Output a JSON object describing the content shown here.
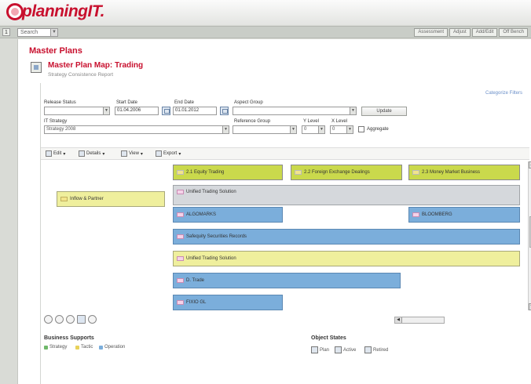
{
  "app": {
    "logo_text": "planningIT."
  },
  "nav": {
    "left_button": "1",
    "select_value": "Search",
    "links": [
      "Assessment",
      "Adjust",
      "Add/Edit",
      "Off Bench"
    ]
  },
  "page": {
    "title": "Master Plans"
  },
  "report": {
    "title": "Master Plan Map: Trading",
    "subtitle": "Strategy Consistence Report"
  },
  "filters": {
    "categorize_link": "Categorize Filters",
    "release_status": {
      "label": "Release Status",
      "value": ""
    },
    "start_date": {
      "label": "Start Date",
      "value": "01.04.2006"
    },
    "end_date": {
      "label": "End Date",
      "value": "01.01.2012"
    },
    "aspect_group": {
      "label": "Aspect Group",
      "value": ""
    },
    "update_button": "Update",
    "it_strategy": {
      "label": "IT Strategy",
      "value": "Strategy 2008"
    },
    "reference_group": {
      "label": "Reference Group",
      "value": ""
    },
    "y_level": {
      "label": "Y Level",
      "value": "0"
    },
    "x_level": {
      "label": "X Level",
      "value": "0"
    },
    "aggregate_label": "Aggregate"
  },
  "toolbar": {
    "edit": "Edit",
    "details": "Details",
    "view": "View",
    "export": "Export"
  },
  "map": {
    "columns": [
      "2.1 Equity Trading",
      "2.2 Foreign Exchange Dealings",
      "2.3 Money Market Business"
    ],
    "row_label": "Inflow & Partner",
    "items": {
      "unified_top": "Unified Trading Solution",
      "blue1": "ALGOMARKS",
      "blue1_right": "BLOOMBERG",
      "blue2": "Safequity Securities Records",
      "yellow_row": "Unified Trading Solution",
      "blue3": "D. Trade",
      "blue4": "FIXIO GL"
    }
  },
  "legend": {
    "business_title": "Business Supports",
    "business_items": [
      "Strategy",
      "Tactic",
      "Operation"
    ],
    "business_colors": [
      "#6fb86a",
      "#e8d25a",
      "#7baedb"
    ],
    "status_title": "Object States",
    "status_items": [
      "Plan",
      "Active",
      "Retired"
    ]
  }
}
